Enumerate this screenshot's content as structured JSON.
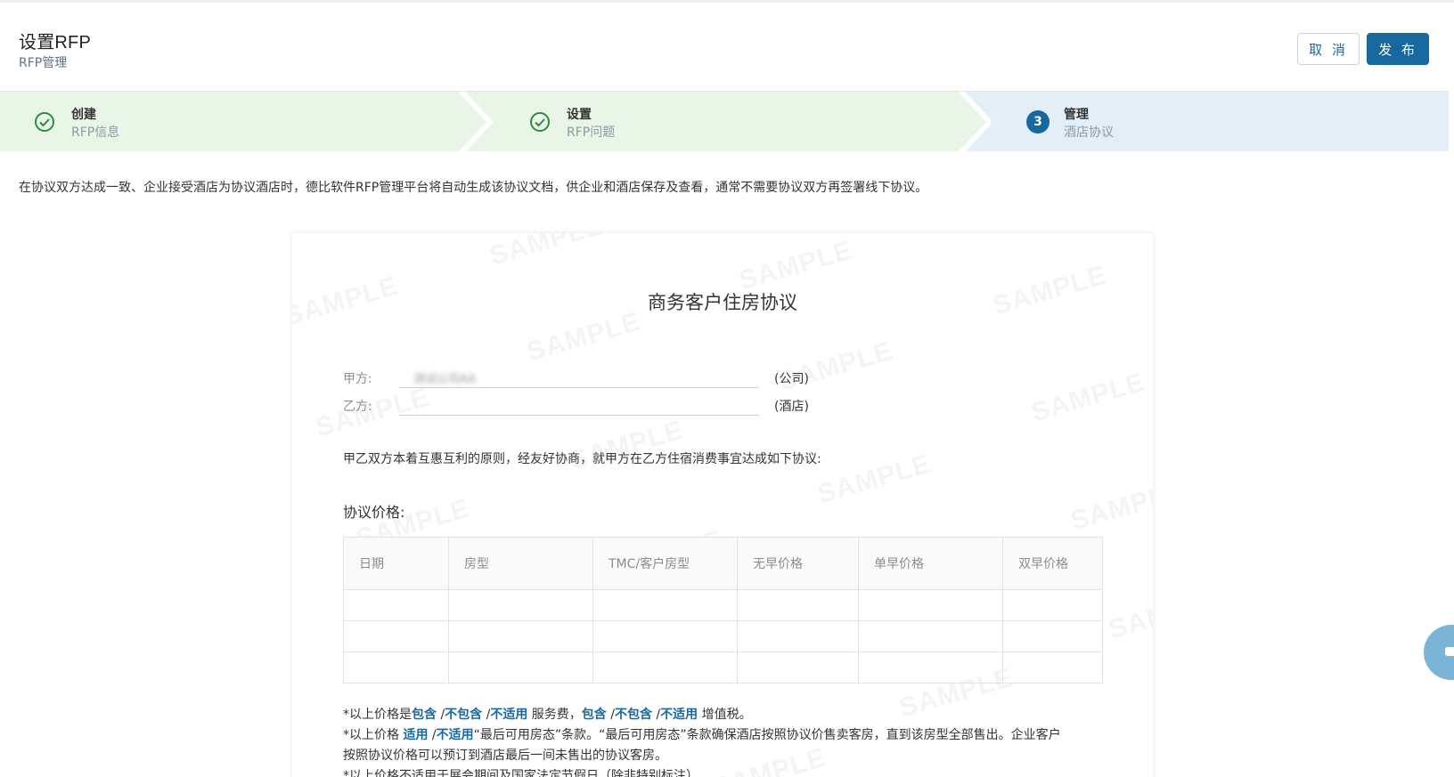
{
  "header": {
    "title": "设置RFP",
    "subtitle": "RFP管理",
    "cancel_label": "取 消",
    "publish_label": "发 布"
  },
  "steps": [
    {
      "title": "创建",
      "subtitle": "RFP信息",
      "status": "done"
    },
    {
      "title": "设置",
      "subtitle": "RFP问题",
      "status": "done"
    },
    {
      "number": "3",
      "title": "管理",
      "subtitle": "酒店协议",
      "status": "active"
    }
  ],
  "intro": "在协议双方达成一致、企业接受酒店为协议酒店时，德比软件RFP管理平台将自动生成该协议文档，供企业和酒店保存及查看，通常不需要协议双方再签署线下协议。",
  "document": {
    "title": "商务客户住房协议",
    "watermark": "SAMPLE",
    "party_a": {
      "label": "甲方:",
      "value": "测试公司AA",
      "suffix": "(公司)"
    },
    "party_b": {
      "label": "乙方:",
      "value": "",
      "suffix": "(酒店)"
    },
    "paragraph": "甲乙双方本着互惠互利的原则，经友好协商，就甲方在乙方住宿消费事宜达成如下协议:",
    "price_section_title": "协议价格:",
    "table": {
      "headers": [
        "日期",
        "房型",
        "TMC/客户房型",
        "无早价格",
        "单早价格",
        "双早价格"
      ],
      "rows": [
        [
          "",
          "",
          "",
          "",
          "",
          ""
        ],
        [
          "",
          "",
          "",
          "",
          "",
          ""
        ],
        [
          "",
          "",
          "",
          "",
          "",
          ""
        ]
      ]
    },
    "notes": {
      "n1_prefix": "*以上价格是",
      "n1_opt1": "包含",
      "n1_opt2": "不包含",
      "n1_opt3": "不适用",
      "n1_mid": " 服务费，",
      "n1_opt4": "包含",
      "n1_opt5": "不包含",
      "n1_opt6": "不适用",
      "n1_suffix": " 增值税。",
      "sep": " /",
      "n2_prefix": "*以上价格 ",
      "n2_opt1": "适用",
      "n2_opt2": "不适用",
      "n2_text1": "“最后可用房态”条款。“最后可用房态”条款确保酒店按照协议价售卖客房，直到该房型全部售出。企业客户",
      "n2_text2": "按照协议价格可以预订到酒店最后一间未售出的协议客房。",
      "n3": "*以上价格不适用于展会期间及国家法定节假日（除非特别标注）"
    }
  }
}
